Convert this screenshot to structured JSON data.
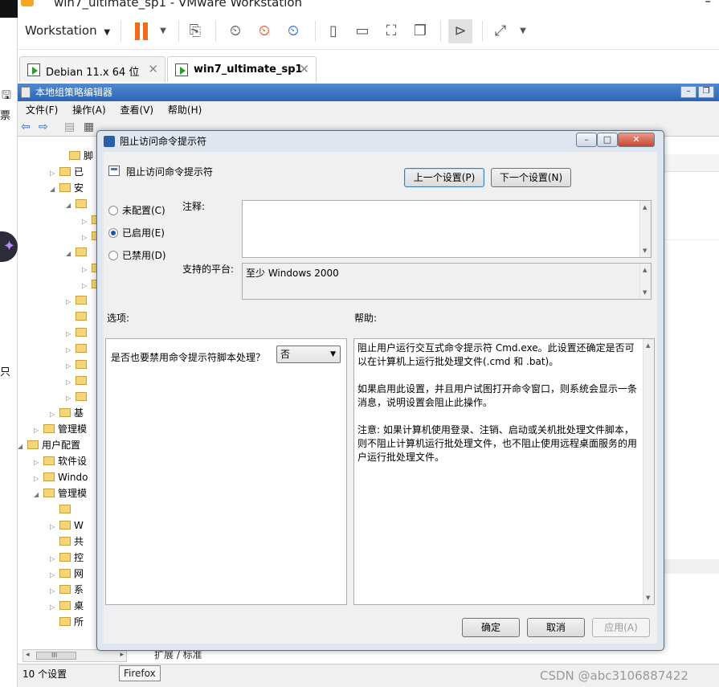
{
  "host": {
    "window_title": "win7_ultimate_sp1 - VMware Workstation",
    "left_strip_glyph": "票",
    "left_strip_glyph2": "只",
    "menu_label": "Workstation",
    "menu_caret": "▼",
    "tabs": [
      {
        "label": "Debian 11.x 64 位",
        "close": "✕"
      },
      {
        "label": "win7_ultimate_sp1",
        "close": "✕"
      }
    ],
    "toolbar_icons": [
      "pause-icon",
      "send-keys-icon",
      "snapshot-take-icon",
      "snapshot-revert-icon",
      "snapshot-manager-icon",
      "sidebar-icon",
      "thumbnail-bar-icon",
      "fullscreen-icon",
      "unity-icon",
      "console-view-icon",
      "stretch-icon"
    ],
    "accent_color": "#f26a1b"
  },
  "gpedit": {
    "title": "本地组策略编辑器",
    "menu": [
      "文件(F)",
      "操作(A)",
      "查看(V)",
      "帮助(H)"
    ],
    "tree": [
      {
        "label": "脚",
        "arrow": "",
        "indent": 66,
        "icon": "script-icon"
      },
      {
        "label": "已",
        "arrow": "▷",
        "indent": 54,
        "icon": "printer-icon"
      },
      {
        "label": "安",
        "arrow": "◢",
        "indent": 54,
        "icon": "security-icon"
      },
      {
        "label": "",
        "arrow": "◢",
        "indent": 74,
        "icon": "folder-icon"
      },
      {
        "label": "",
        "arrow": "▷",
        "indent": 94,
        "icon": "folder-icon"
      },
      {
        "label": "",
        "arrow": "▷",
        "indent": 94,
        "icon": "folder-icon"
      },
      {
        "label": "",
        "arrow": "◢",
        "indent": 74,
        "icon": "folder-icon"
      },
      {
        "label": "",
        "arrow": "▷",
        "indent": 94,
        "icon": "folder-icon"
      },
      {
        "label": "",
        "arrow": "▷",
        "indent": 94,
        "icon": "folder-icon"
      },
      {
        "label": "",
        "arrow": "▷",
        "indent": 74,
        "icon": "folder-icon"
      },
      {
        "label": "",
        "arrow": "",
        "indent": 74,
        "icon": "folder-icon"
      },
      {
        "label": "",
        "arrow": "▷",
        "indent": 74,
        "icon": "folder-icon"
      },
      {
        "label": "",
        "arrow": "▷",
        "indent": 74,
        "icon": "folder-icon"
      },
      {
        "label": "",
        "arrow": "▷",
        "indent": 74,
        "icon": "folder-icon"
      },
      {
        "label": "",
        "arrow": "▷",
        "indent": 74,
        "icon": "folder-icon"
      },
      {
        "label": "",
        "arrow": "▷",
        "indent": 74,
        "icon": "folder-icon"
      },
      {
        "label": "基",
        "arrow": "▷",
        "indent": 54,
        "icon": "chart-icon"
      },
      {
        "label": "管理模",
        "arrow": "▷",
        "indent": 34,
        "icon": "folder-icon"
      },
      {
        "label": "用户配置",
        "arrow": "◢",
        "indent": 14,
        "icon": "user-icon"
      },
      {
        "label": "软件设",
        "arrow": "▷",
        "indent": 34,
        "icon": "folder-icon"
      },
      {
        "label": "Windo",
        "arrow": "▷",
        "indent": 34,
        "icon": "folder-icon"
      },
      {
        "label": "管理模",
        "arrow": "◢",
        "indent": 34,
        "icon": "folder-icon"
      },
      {
        "label": "",
        "arrow": "",
        "indent": 54,
        "icon": "folder-icon"
      },
      {
        "label": "W",
        "arrow": "▷",
        "indent": 54,
        "icon": "folder-icon"
      },
      {
        "label": "共",
        "arrow": "",
        "indent": 54,
        "icon": "folder-icon"
      },
      {
        "label": "控",
        "arrow": "▷",
        "indent": 54,
        "icon": "folder-icon"
      },
      {
        "label": "网",
        "arrow": "▷",
        "indent": 54,
        "icon": "folder-icon"
      },
      {
        "label": "系",
        "arrow": "▷",
        "indent": 54,
        "icon": "folder-icon"
      },
      {
        "label": "桌",
        "arrow": "▷",
        "indent": 54,
        "icon": "folder-icon"
      },
      {
        "label": "所",
        "arrow": "",
        "indent": 54,
        "icon": "folder-icon"
      }
    ],
    "scroll_label": "III",
    "bottom_tabs": "扩展 / 标准",
    "status": "10 个设置",
    "tooltip": "Firefox"
  },
  "dialog": {
    "title": "阻止访问命令提示符",
    "setting_name": "阻止访问命令提示符",
    "prev_button": "上一个设置(P)",
    "next_button": "下一个设置(N)",
    "radios": [
      {
        "label": "未配置(C)",
        "checked": false
      },
      {
        "label": "已启用(E)",
        "checked": true
      },
      {
        "label": "已禁用(D)",
        "checked": false
      }
    ],
    "comment_label": "注释:",
    "comment_value": "",
    "platform_label": "支持的平台:",
    "platform_value": "至少 Windows 2000",
    "options_label": "选项:",
    "help_label": "帮助:",
    "option_prompt": "是否也要禁用命令提示符脚本处理？",
    "option_value": "否",
    "help_paragraphs": [
      "阻止用户运行交互式命令提示符 Cmd.exe。此设置还确定是否可以在计算机上运行批处理文件(.cmd 和 .bat)。",
      "如果启用此设置，并且用户试图打开命令窗口，则系统会显示一条消息，说明设置会阻止此操作。",
      "注意: 如果计算机使用登录、注销、启动或关机批处理文件脚本，则不阻止计算机运行批处理文件，也不阻止使用远程桌面服务的用户运行批处理文件。"
    ],
    "ok_button": "确定",
    "cancel_button": "取消",
    "apply_button": "应用(A)"
  },
  "watermark": "CSDN @abc3106887422"
}
